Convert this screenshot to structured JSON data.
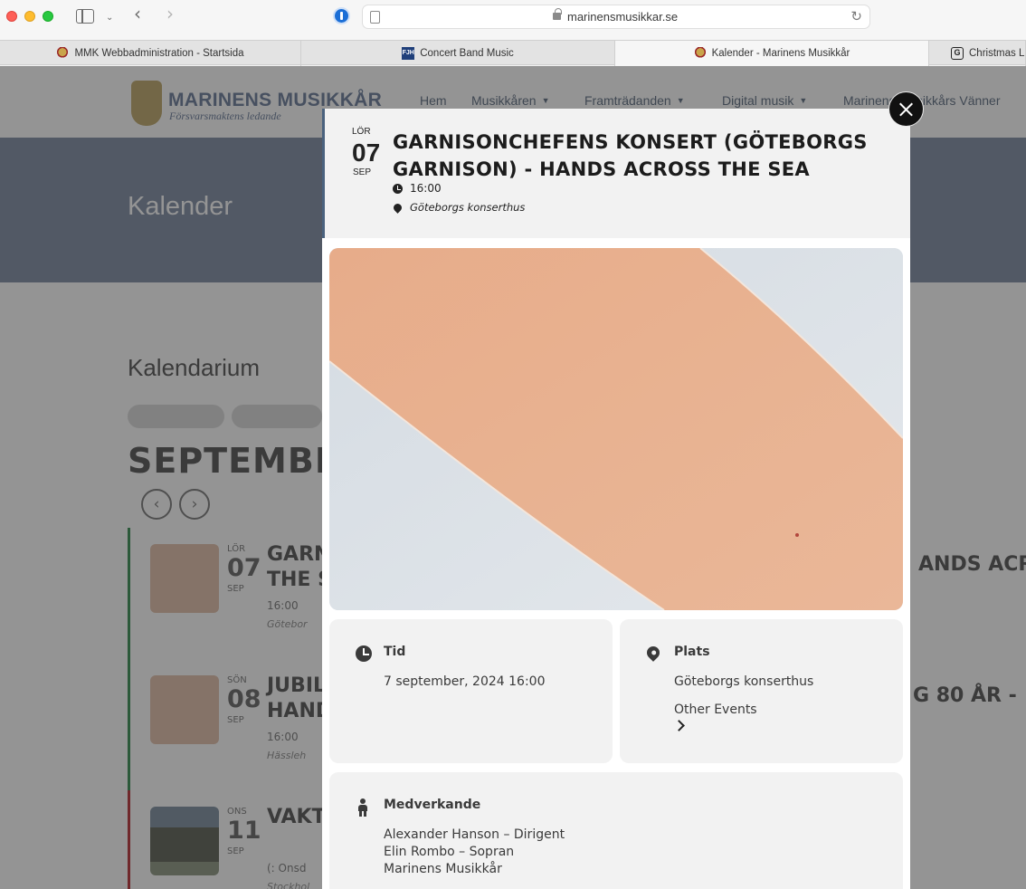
{
  "browser": {
    "url": "marinensmusikkar.se",
    "tabs": [
      {
        "label": "MMK Webbadministration - Startsida",
        "icon": "crest-favicon",
        "active": false
      },
      {
        "label": "Concert Band Music",
        "icon": "FJH",
        "active": false
      },
      {
        "label": "Kalender - Marinens Musikkår",
        "icon": "crest-favicon",
        "active": true
      },
      {
        "label": "Christmas L",
        "icon": "xmas-favicon",
        "active": false
      }
    ]
  },
  "site": {
    "logo_name": "MARINENS MUSIKKÅR",
    "logo_tagline": "Försvarsmaktens ledande",
    "nav": [
      "Hem",
      "Musikkåren",
      "Framträdanden",
      "Digital musik",
      "Marinens Musikkårs Vänner"
    ],
    "hero_title": "Kalender",
    "section_title": "Kalendarium",
    "month_heading": "SEPTEMBE",
    "events": [
      {
        "dow": "LÖR",
        "day": "07",
        "mon": "SEP",
        "title_left": "GARN",
        "title_left2": "THE S",
        "title_right": "ANDS ACRO",
        "time": "16:00",
        "location": "Götebor"
      },
      {
        "dow": "SÖN",
        "day": "08",
        "mon": "SEP",
        "title_left": "JUBIL",
        "title_left2": "HAND",
        "title_right": "G 80 ÅR -",
        "time": "16:00",
        "location": "Hässleh"
      },
      {
        "dow": "ONS",
        "day": "11",
        "mon": "SEP",
        "title_left": "VAKT",
        "time": "(: Onsd",
        "location": "Stockhol"
      }
    ]
  },
  "modal": {
    "dow": "LÖR",
    "day": "07",
    "month": "SEP",
    "title": "GARNISONCHEFENS KONSERT (GÖTEBORGS GARNISON) - HANDS ACROSS THE SEA",
    "time": "16:00",
    "location": "Göteborgs konserthus",
    "tid_label": "Tid",
    "tid_value": "7 september, 2024 16:00",
    "plats_label": "Plats",
    "plats_value": "Göteborgs konserthus",
    "other_events": "Other Events",
    "medverkande_label": "Medverkande",
    "medverkande": [
      "Alexander Hanson – Dirigent",
      "Elin Rombo – Sopran",
      "Marinens Musikkår"
    ]
  },
  "colors": {
    "modal_accent": "#4a627e",
    "event_green": "#4d9a65",
    "event_red": "#c0454b",
    "close_button": "#111111"
  }
}
